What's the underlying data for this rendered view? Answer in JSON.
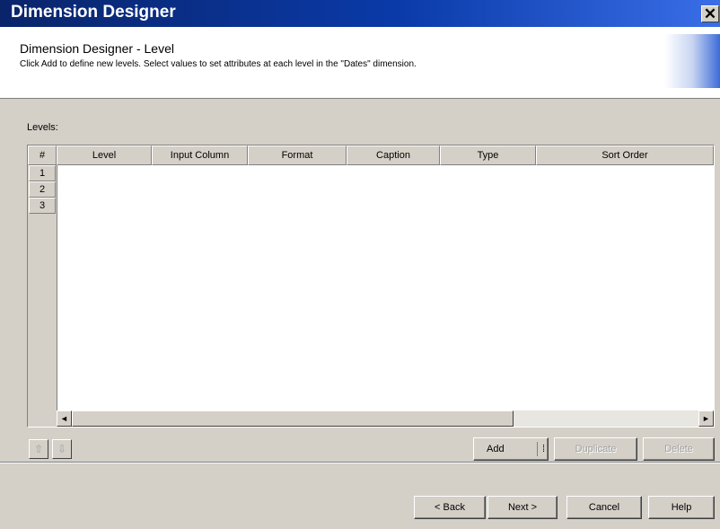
{
  "window": {
    "title": "Dimension Designer",
    "close_label": "✕"
  },
  "header": {
    "title": "Dimension Designer - Level",
    "description": "Click Add to define new levels. Select values to set attributes at each level in the \"Dates\" dimension."
  },
  "levels": {
    "label": "Levels:",
    "corner": "#",
    "columns": [
      "Level",
      "Input Column",
      "Format",
      "Caption",
      "Type",
      "Sort Order"
    ],
    "rows": [
      "1",
      "2",
      "3"
    ]
  },
  "scrollbar": {
    "left_arrow": "◄",
    "right_arrow": "►"
  },
  "move": {
    "up": "⇧",
    "down": "⇩"
  },
  "actions": {
    "add": "Add",
    "add_split": "⁞",
    "duplicate": "Duplicate",
    "delete": "Delete"
  },
  "nav": {
    "back": "< Back",
    "next": "Next >",
    "cancel": "Cancel",
    "help": "Help"
  }
}
